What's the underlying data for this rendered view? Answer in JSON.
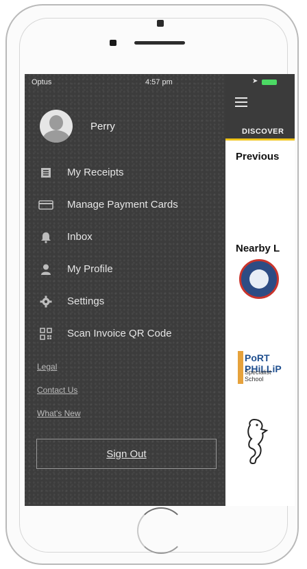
{
  "status_bar": {
    "carrier": "Optus",
    "time": "4:57 pm"
  },
  "profile": {
    "name": "Perry"
  },
  "menu": {
    "items": [
      {
        "label": "My Receipts",
        "icon": "receipt-icon"
      },
      {
        "label": "Manage Payment Cards",
        "icon": "credit-card-icon"
      },
      {
        "label": "Inbox",
        "icon": "bell-icon"
      },
      {
        "label": "My Profile",
        "icon": "person-icon"
      },
      {
        "label": "Settings",
        "icon": "gear-icon"
      },
      {
        "label": "Scan Invoice QR Code",
        "icon": "qr-code-icon"
      }
    ]
  },
  "links": {
    "legal": "Legal",
    "contact": "Contact Us",
    "whats_new": "What's New"
  },
  "signout": {
    "label": "Sign Out"
  },
  "main": {
    "tab": "DISCOVER",
    "sections": {
      "previous": "Previous",
      "nearby": "Nearby L"
    },
    "logo_texts": {
      "school2_line1": "PoRT PHiLLiP",
      "school2_line2": "Specialist School"
    }
  },
  "colors": {
    "drawer_bg": "#3c3c3c",
    "tab_accent": "#f0c419",
    "battery": "#4cd964"
  }
}
